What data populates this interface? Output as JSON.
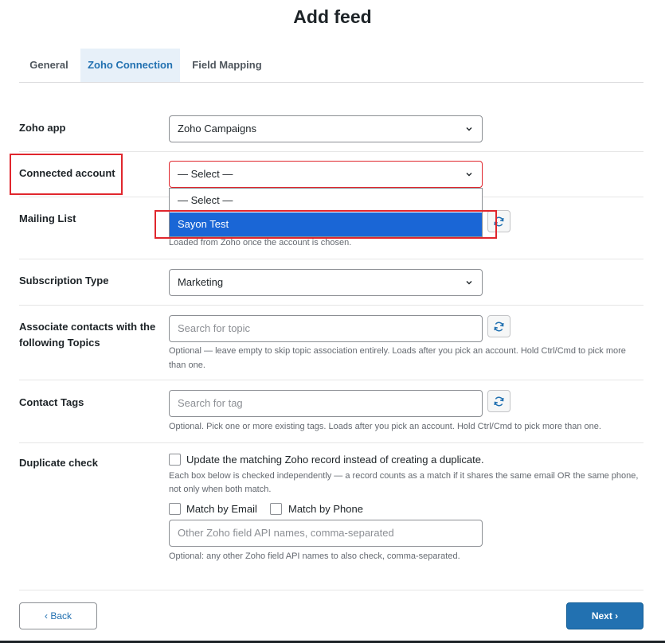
{
  "page": {
    "title": "Add feed"
  },
  "tabs": [
    {
      "label": "General"
    },
    {
      "label": "Zoho Connection"
    },
    {
      "label": "Field Mapping"
    }
  ],
  "form": {
    "zoho_app": {
      "label": "Zoho app",
      "value": "Zoho Campaigns"
    },
    "connected_account": {
      "label": "Connected account",
      "value": "— Select —",
      "options": [
        "— Select —",
        "Sayon Test"
      ],
      "highlighted_option": "Sayon Test"
    },
    "mailing_list": {
      "label": "Mailing List",
      "help": "Loaded from Zoho once the account is chosen."
    },
    "subscription_type": {
      "label": "Subscription Type",
      "value": "Marketing"
    },
    "topics": {
      "label_line1": "Associate contacts with the",
      "label_line2": "following Topics",
      "placeholder": "Search for topic",
      "help_line1": "Optional — leave empty to skip topic association entirely. Loads after you pick an account. Hold Ctrl/Cmd to pick more",
      "help_line2": "than one."
    },
    "tags": {
      "label": "Contact Tags",
      "placeholder": "Search for tag",
      "help": "Optional. Pick one or more existing tags. Loads after you pick an account. Hold Ctrl/Cmd to pick more than one."
    },
    "duplicate_check": {
      "label": "Duplicate check",
      "update_label": "Update the matching Zoho record instead of creating a duplicate.",
      "help_line1": "Each box below is checked independently — a record counts as a match if it shares the same email OR the same phone,",
      "help_line2": "not only when both match.",
      "match_email_label": "Match by Email",
      "match_phone_label": "Match by Phone",
      "other_fields_placeholder": "Other Zoho field API names, comma-separated",
      "other_fields_help": "Optional: any other Zoho field API names to also check, comma-separated."
    }
  },
  "footer": {
    "back_label": "‹ Back",
    "next_label": "Next ›"
  },
  "colors": {
    "accent": "#2271b1",
    "highlight": "#1a66d6",
    "annotation": "#e0262d"
  }
}
